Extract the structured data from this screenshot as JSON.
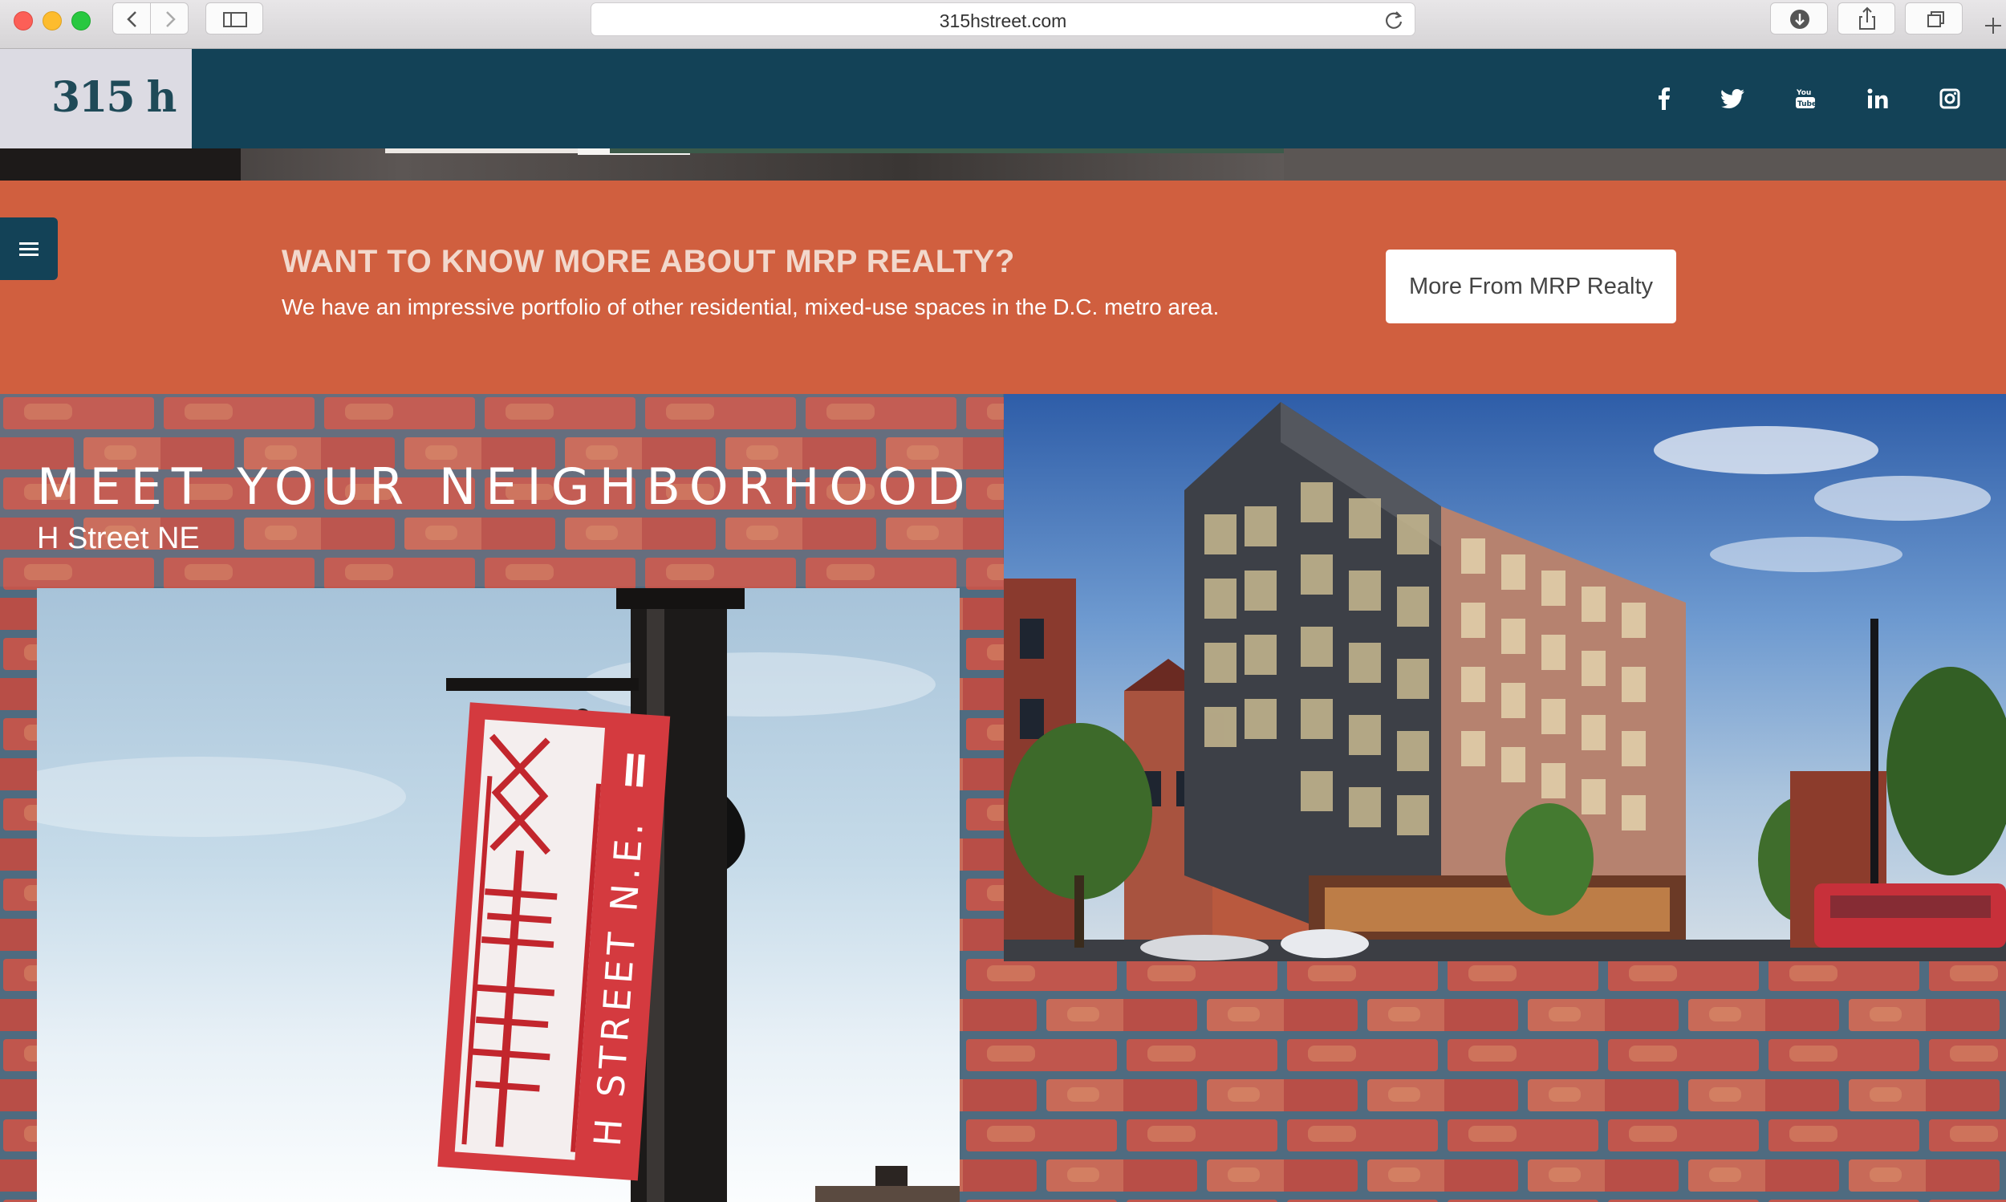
{
  "browser": {
    "url": "315hstreet.com"
  },
  "header": {
    "logo_text": "315 h",
    "social_icons": [
      "facebook-icon",
      "twitter-icon",
      "youtube-icon",
      "linkedin-icon",
      "instagram-icon"
    ]
  },
  "cta": {
    "heading": "WANT TO KNOW MORE ABOUT MRP REALTY?",
    "subtext": "We have an impressive portfolio of other residential, mixed-use spaces in the D.C. metro area.",
    "button_label": "More From MRP Realty"
  },
  "neighborhood": {
    "title": "MEET YOUR NEIGHBORHOOD",
    "subtitle": "H Street NE",
    "sign_text": "H STREET N.E."
  },
  "colors": {
    "header_bg": "#134257",
    "cta_bg": "#d05f3f",
    "logo_bg": "#dcdbe3"
  }
}
